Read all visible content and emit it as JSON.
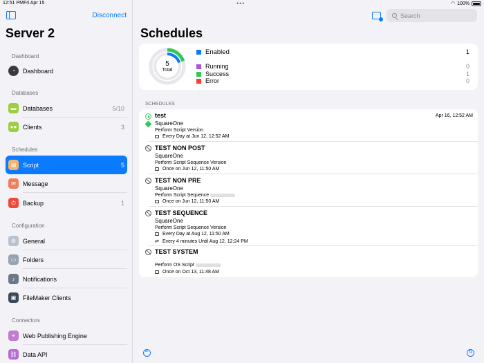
{
  "status": {
    "time": "12:51 PM",
    "date": "Fri Apr 15",
    "battery": "100%"
  },
  "sidebar": {
    "disconnect": "Disconnect",
    "title": "Server 2",
    "sections": {
      "dashboard": "Dashboard",
      "databases": "Databases",
      "schedules": "Schedules",
      "configuration": "Configuration",
      "connectors": "Connectors"
    },
    "items": {
      "dashboard": {
        "label": "Dashboard",
        "icon": "dashboard-icon",
        "color": "#3a3a3c"
      },
      "databases": {
        "label": "Databases",
        "count": "5/10",
        "icon": "database-icon",
        "color": "#9bcf3e"
      },
      "clients": {
        "label": "Clients",
        "count": "3",
        "icon": "clients-icon",
        "color": "#9bcf3e"
      },
      "script": {
        "label": "Script",
        "count": "5",
        "icon": "script-icon",
        "color": "#f6b26b"
      },
      "message": {
        "label": "Message",
        "icon": "message-icon",
        "color": "#ef7d5f"
      },
      "backup": {
        "label": "Backup",
        "count": "1",
        "icon": "backup-icon",
        "color": "#ee4a3c"
      },
      "general": {
        "label": "General",
        "icon": "general-icon",
        "color": "#b9c3cf"
      },
      "folders": {
        "label": "Folders",
        "icon": "folder-icon",
        "color": "#95a3b3"
      },
      "notifications": {
        "label": "Notifications",
        "icon": "bell-icon",
        "color": "#6b7a89"
      },
      "filemaker": {
        "label": "FileMaker Clients",
        "icon": "filemaker-client-icon",
        "color": "#3a4a5a"
      },
      "wpe": {
        "label": "Web Publishing Engine",
        "icon": "web-publishing-icon",
        "color": "#c27bd0"
      },
      "dataapi": {
        "label": "Data API",
        "icon": "data-api-icon",
        "color": "#b86bd3"
      }
    }
  },
  "search": {
    "placeholder": "Search"
  },
  "main": {
    "title": "Schedules",
    "summary": {
      "total": "5",
      "total_label": "Total",
      "enabled": {
        "label": "Enabled",
        "value": "1",
        "color": "#0a7aff"
      },
      "running": {
        "label": "Running",
        "value": "0",
        "color": "#af52de"
      },
      "success": {
        "label": "Success",
        "value": "1",
        "color": "#34c759"
      },
      "error": {
        "label": "Error",
        "value": "0",
        "color": "#ff3b30"
      }
    },
    "list_header": "SCHEDULES",
    "schedules": [
      {
        "name": "test",
        "server": "SquareOne",
        "task": "Perform Script Version",
        "when": "Every Day  at Jun 12, 12:52 AM",
        "last_run": "Apr 16, 12:52 AM"
      },
      {
        "name": "TEST NON POST",
        "server": "SquareOne",
        "task": "Perform Script Sequence Version",
        "when": "Once on Jun 12, 11:50 AM"
      },
      {
        "name": "TEST NON PRE",
        "server": "SquareOne",
        "task": "Perform Script Sequence",
        "when": "Once on Jun 12, 11:50 AM"
      },
      {
        "name": "TEST SEQUENCE",
        "server": "SquareOne",
        "task": "Perform Script Sequence Version",
        "when": "Every Day  at Aug 12, 11:50 AM",
        "repeat": "Every 4 minutes Until Aug 12, 12:24 PM"
      },
      {
        "name": "TEST SYSTEM",
        "task": "Perform OS Script",
        "when": "Once on Oct 13, 11:48 AM"
      }
    ]
  }
}
